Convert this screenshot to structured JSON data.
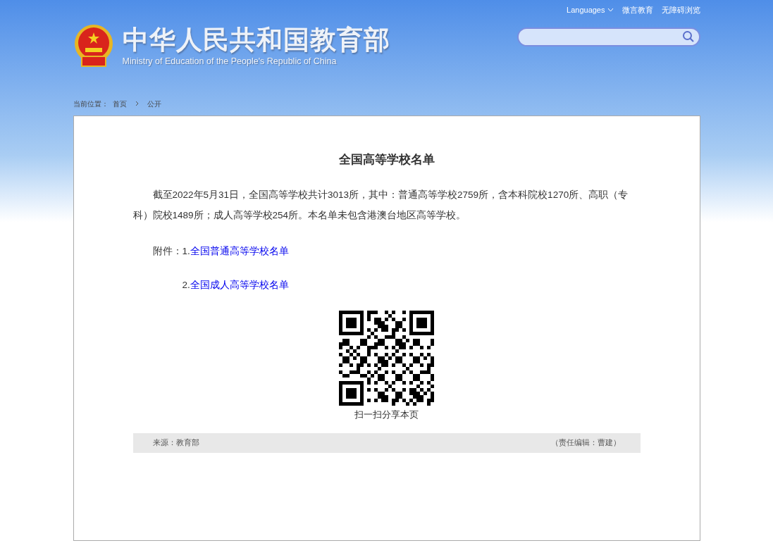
{
  "top_links": [
    {
      "label": "Languages",
      "kind": "dropdown"
    },
    {
      "label": "微言教育",
      "kind": "link"
    },
    {
      "label": "无障碍浏览",
      "kind": "link"
    }
  ],
  "logo": {
    "title": "中华人民共和国教育部",
    "subtitle": "Ministry of Education of the People's Republic of China"
  },
  "breadcrumb": {
    "label": "当前位置：",
    "items": [
      "首页",
      "公开"
    ]
  },
  "article": {
    "title": "全国高等学校名单",
    "paragraph": "截至2022年5月31日，全国高等学校共计3013所，其中：普通高等学校2759所，含本科院校1270所、高职（专科）院校1489所；成人高等学校254所。本名单未包含港澳台地区高等学校。",
    "attachments_label": "附件：",
    "attachments": [
      {
        "number": "1.",
        "link": "全国普通高等学校名单"
      },
      {
        "number": "2.",
        "link": "全国成人高等学校名单"
      }
    ],
    "qr_caption": "扫一扫分享本页"
  },
  "footer": {
    "source": "来源：教育部",
    "editor": "（责任编辑：曹建）"
  }
}
